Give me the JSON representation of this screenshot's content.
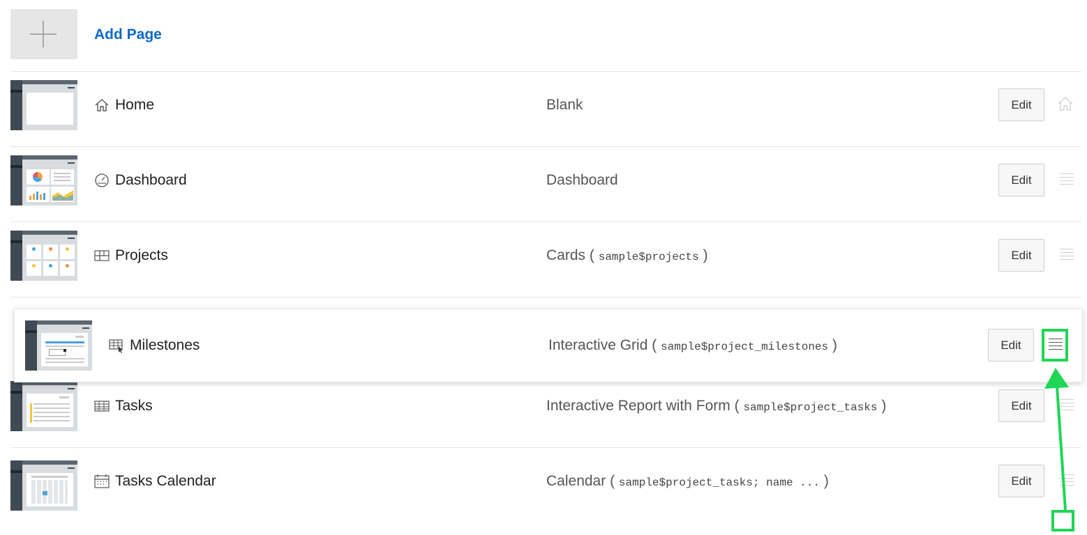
{
  "add_page": {
    "label": "Add Page",
    "icon": "plus-icon"
  },
  "pages": [
    {
      "name": "Home",
      "icon": "home-icon",
      "type": "Blank",
      "source": "",
      "edit_label": "Edit",
      "marker": "home-icon"
    },
    {
      "name": "Dashboard",
      "icon": "dashboard-gauge-icon",
      "type": "Dashboard",
      "source": "",
      "edit_label": "Edit",
      "marker": "drag-handle-icon"
    },
    {
      "name": "Projects",
      "icon": "cards-icon",
      "type": "Cards",
      "source": "sample$projects",
      "edit_label": "Edit",
      "marker": "drag-handle-icon"
    },
    {
      "name": "Milestones",
      "icon": "interactive-grid-icon",
      "type": "Interactive Grid",
      "source": "sample$project_milestones",
      "edit_label": "Edit",
      "marker": "drag-handle-icon"
    },
    {
      "name": "Tasks",
      "icon": "report-table-icon",
      "type": "Interactive Report with Form",
      "source": "sample$project_tasks",
      "edit_label": "Edit",
      "marker": "drag-handle-icon"
    },
    {
      "name": "Tasks Calendar",
      "icon": "calendar-icon",
      "type": "Calendar",
      "source": "sample$project_tasks; name ...",
      "edit_label": "Edit",
      "marker": "drag-handle-icon"
    }
  ],
  "annotation": {
    "color": "#1fd655",
    "meaning": "drag"
  }
}
